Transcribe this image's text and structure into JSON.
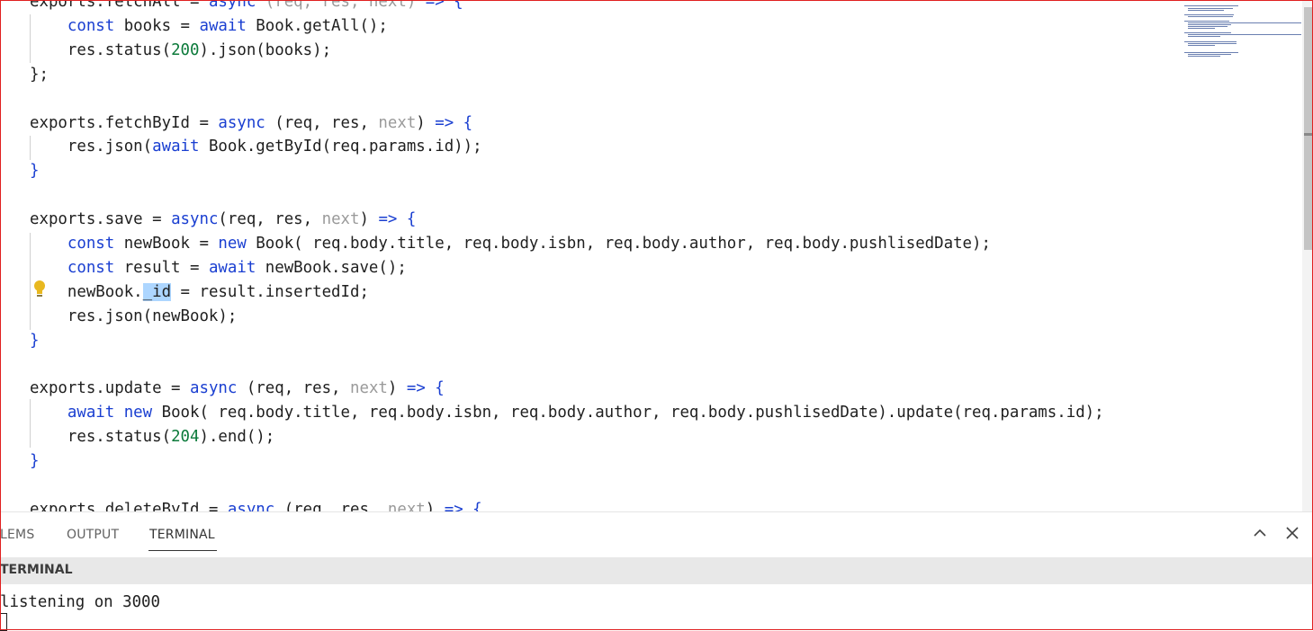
{
  "editor": {
    "lines": [
      [
        {
          "t": "exports.fetchAll = ",
          "c": "p"
        },
        {
          "t": "async ",
          "c": "kw"
        },
        {
          "t": "(req, res, next) ",
          "c": "dim"
        },
        {
          "t": "=> {",
          "c": "kw"
        }
      ],
      [
        {
          "t": "    const ",
          "c": "kw"
        },
        {
          "t": "books = ",
          "c": "p"
        },
        {
          "t": "await ",
          "c": "kw"
        },
        {
          "t": "Book.getAll();",
          "c": "p"
        }
      ],
      [
        {
          "t": "    res.status(",
          "c": "p"
        },
        {
          "t": "200",
          "c": "num"
        },
        {
          "t": ").json(books);",
          "c": "p"
        }
      ],
      [
        {
          "t": "};",
          "c": "p"
        }
      ],
      [],
      [
        {
          "t": "exports.fetchById = ",
          "c": "p"
        },
        {
          "t": "async ",
          "c": "kw"
        },
        {
          "t": "(req, res, ",
          "c": "p"
        },
        {
          "t": "next",
          "c": "dim"
        },
        {
          "t": ") ",
          "c": "p"
        },
        {
          "t": "=> {",
          "c": "kw"
        }
      ],
      [
        {
          "t": "    res.json(",
          "c": "p"
        },
        {
          "t": "await ",
          "c": "kw"
        },
        {
          "t": "Book.getById(req.params.id));",
          "c": "p"
        }
      ],
      [
        {
          "t": "}",
          "c": "kw"
        }
      ],
      [],
      [
        {
          "t": "exports.save = ",
          "c": "p"
        },
        {
          "t": "async",
          "c": "kw"
        },
        {
          "t": "(req, res, ",
          "c": "p"
        },
        {
          "t": "next",
          "c": "dim"
        },
        {
          "t": ") ",
          "c": "p"
        },
        {
          "t": "=> {",
          "c": "kw"
        }
      ],
      [
        {
          "t": "    const ",
          "c": "kw"
        },
        {
          "t": "newBook = ",
          "c": "p"
        },
        {
          "t": "new ",
          "c": "kw"
        },
        {
          "t": "Book( req.body.title, req.body.isbn, req.body.author, req.body.pushlisedDate);",
          "c": "p"
        }
      ],
      [
        {
          "t": "    const ",
          "c": "kw"
        },
        {
          "t": "result = ",
          "c": "p"
        },
        {
          "t": "await ",
          "c": "kw"
        },
        {
          "t": "newBook.save();",
          "c": "p"
        }
      ],
      [
        {
          "t": "    newBook.",
          "c": "p"
        },
        {
          "t": "_id",
          "c": "sel"
        },
        {
          "t": " = result.insertedId;",
          "c": "p"
        }
      ],
      [
        {
          "t": "    res.json(newBook);",
          "c": "p"
        }
      ],
      [
        {
          "t": "}",
          "c": "kw"
        }
      ],
      [],
      [
        {
          "t": "exports.update = ",
          "c": "p"
        },
        {
          "t": "async ",
          "c": "kw"
        },
        {
          "t": "(req, res, ",
          "c": "p"
        },
        {
          "t": "next",
          "c": "dim"
        },
        {
          "t": ") ",
          "c": "p"
        },
        {
          "t": "=> {",
          "c": "kw"
        }
      ],
      [
        {
          "t": "    await new ",
          "c": "kw"
        },
        {
          "t": "Book( req.body.title, req.body.isbn, req.body.author, req.body.pushlisedDate).update(req.params.id);",
          "c": "p"
        }
      ],
      [
        {
          "t": "    res.status(",
          "c": "p"
        },
        {
          "t": "204",
          "c": "num"
        },
        {
          "t": ").end();",
          "c": "p"
        }
      ],
      [
        {
          "t": "}",
          "c": "kw"
        }
      ],
      [],
      [
        {
          "t": "exports.deleteById = ",
          "c": "p"
        },
        {
          "t": "async ",
          "c": "kw"
        },
        {
          "t": "(req, res, ",
          "c": "p"
        },
        {
          "t": "next",
          "c": "dim"
        },
        {
          "t": ") ",
          "c": "p"
        },
        {
          "t": "=> {",
          "c": "kw"
        }
      ]
    ]
  },
  "panel": {
    "tabs": [
      {
        "label": "LEMS",
        "active": false
      },
      {
        "label": "OUTPUT",
        "active": false
      },
      {
        "label": "TERMINAL",
        "active": true
      }
    ],
    "terminal_title": "TERMINAL",
    "terminal_output": "listening on 3000"
  },
  "icons": {
    "lightbulb": "lightbulb-icon",
    "maximize": "chevron-up-icon",
    "close": "close-icon"
  },
  "colors": {
    "keyword": "#1a3fd1",
    "number": "#0b7a3a",
    "dim": "#9a9a9a",
    "selection": "#add6ff",
    "lightbulb": "#e8b820",
    "frame": "#e02020"
  }
}
